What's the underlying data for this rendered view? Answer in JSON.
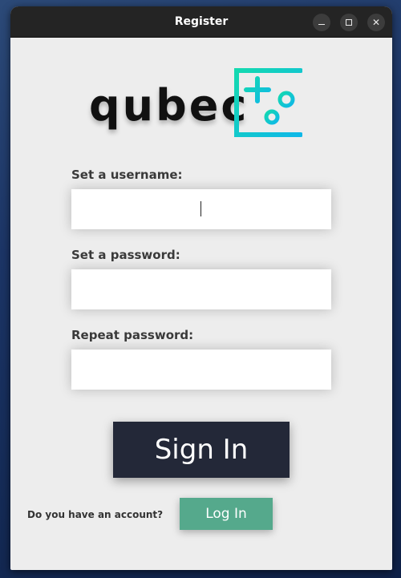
{
  "window": {
    "title": "Register",
    "controls": [
      "minimize-icon",
      "maximize-icon",
      "close-icon"
    ],
    "close_glyph": "✕"
  },
  "brand": {
    "logo_text": "qubec",
    "accent_colors": [
      "#14d9b0",
      "#0fb8e8"
    ]
  },
  "form": {
    "username_label": "Set a username:",
    "username_value": "",
    "password_label": "Set a password:",
    "password_value": "",
    "repeat_label": "Repeat password:",
    "repeat_value": ""
  },
  "actions": {
    "sign_in_label": "Sign In",
    "account_prompt": "Do you have an account?",
    "log_in_label": "Log In"
  },
  "colors": {
    "window_bg": "#ededed",
    "titlebar_bg": "#242424",
    "sign_in_bg": "#232838",
    "log_in_bg": "#55a98c"
  }
}
